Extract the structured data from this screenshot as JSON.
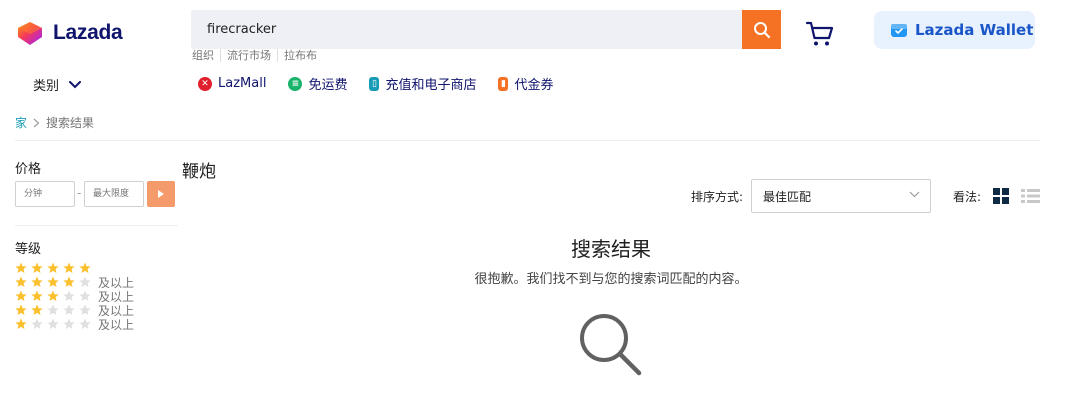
{
  "header": {
    "brand": "Lazada",
    "search": {
      "value": "firecracker"
    },
    "hint_links": [
      "组织",
      "流行市场",
      "拉布布"
    ],
    "wallet_label": "Lazada Wallet",
    "category_label": "类别",
    "quick_links": [
      {
        "label": "LazMall",
        "icon": "lazmall-icon",
        "color": "#e0202c"
      },
      {
        "label": "免运费",
        "icon": "free-shipping-icon",
        "color": "#19b36b"
      },
      {
        "label": "充值和电子商店",
        "icon": "mobile-topup-icon",
        "color": "#1a9cb7"
      },
      {
        "label": "代金券",
        "icon": "voucher-icon",
        "color": "#f57224"
      }
    ]
  },
  "breadcrumb": {
    "home": "家",
    "current": "搜索结果"
  },
  "sidebar": {
    "price": {
      "title": "价格",
      "min_placeholder": "分钟",
      "separator": "-",
      "max_placeholder": "最大限度"
    },
    "rating": {
      "title": "等级",
      "rows": [
        {
          "stars": 5,
          "label": ""
        },
        {
          "stars": 4,
          "label": "及以上"
        },
        {
          "stars": 3,
          "label": "及以上"
        },
        {
          "stars": 2,
          "label": "及以上"
        },
        {
          "stars": 1,
          "label": "及以上"
        }
      ]
    }
  },
  "main": {
    "query_title": "鞭炮",
    "sort_label": "排序方式:",
    "sort_value": "最佳匹配",
    "view_label": "看法:",
    "empty_title": "搜索结果",
    "empty_message": "很抱歉。我们找不到与您的搜索词匹配的内容。"
  },
  "colors": {
    "accent": "#f57224",
    "brand_navy": "#0f146d",
    "star_filled": "#fbc02d",
    "star_empty": "#e0e0e0",
    "link": "#1a9cb7"
  }
}
